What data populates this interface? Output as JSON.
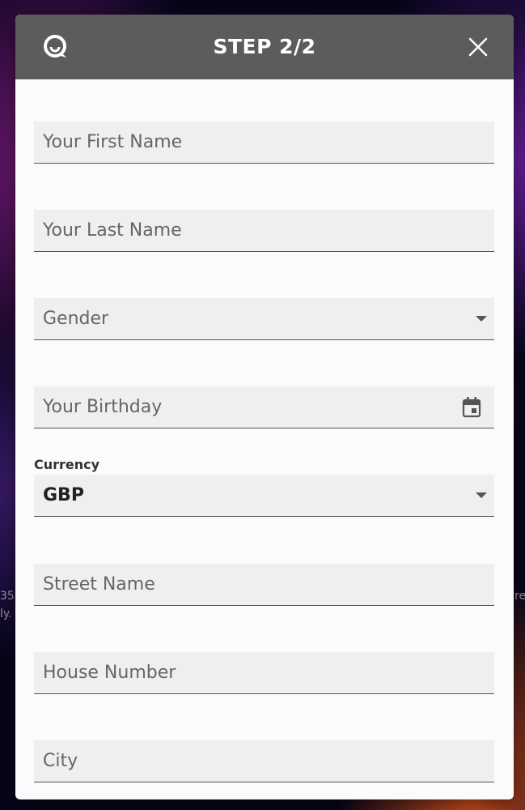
{
  "background": {
    "fragment_left": "35",
    "fragment_left2": "ly.",
    "fragment_right": "re"
  },
  "header": {
    "title": "STEP 2/2",
    "support_icon": "chat-support-icon",
    "close_icon": "close-icon"
  },
  "form": {
    "first_name": {
      "placeholder": "Your First Name"
    },
    "last_name": {
      "placeholder": "Your Last Name"
    },
    "gender": {
      "placeholder": "Gender",
      "icon": "chevron-down-icon"
    },
    "birthday": {
      "placeholder": "Your Birthday",
      "icon": "calendar-icon"
    },
    "currency": {
      "label": "Currency",
      "value": "GBP",
      "icon": "chevron-down-icon"
    },
    "street": {
      "placeholder": "Street Name"
    },
    "house_number": {
      "placeholder": "House Number"
    },
    "city": {
      "placeholder": "City"
    }
  },
  "colors": {
    "header_bg": "#5c5c5c",
    "modal_bg": "#fbfafc",
    "field_bg": "#efeef0"
  }
}
